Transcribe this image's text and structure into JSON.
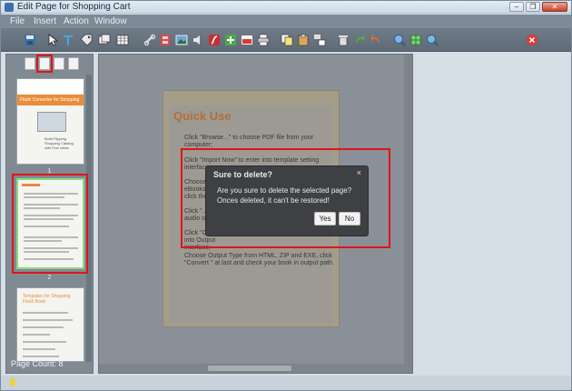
{
  "window": {
    "title": "Edit Page for Shopping Cart",
    "minimize": "–",
    "restore": "❐",
    "close": "✕"
  },
  "menu": {
    "items": [
      "File",
      "Insert",
      "Action",
      "Window"
    ]
  },
  "toolbar": {
    "icons": [
      "save-icon",
      "pointer-icon",
      "text-icon",
      "tag-icon",
      "picture-icon",
      "table-icon",
      "link-icon",
      "film-icon",
      "image-icon",
      "audio-icon",
      "flash-icon",
      "add-icon",
      "youtube-icon",
      "print-icon",
      "copy-icon",
      "paste-icon",
      "align-icon",
      "delete-icon",
      "redo-icon",
      "undo-icon",
      "zoom-in-icon",
      "fit-icon",
      "zoom-out-icon",
      "close-icon"
    ]
  },
  "left_panel": {
    "page_count": "Page Count: 8",
    "thumb1_title": "Flash Converter for Shopping",
    "thumb1_caption": "Build Flipping Shopping Catalog with Few clicks",
    "thumb1_num": "1",
    "thumb2_num": "2",
    "thumb3_title": "Templates for Shopping Flash Book"
  },
  "page": {
    "title": "Quick Use",
    "steps": [
      "Click  \"Browse...\" to choose PDF file from your computer;",
      "Click \"Import Now\" to enter into template setting interface;",
      "Choose... eBooks,... click the...",
      "Click \"...\" audio o...",
      "Click \"C... into Output interface;",
      "Choose Output Type from HTML, ZIP and EXE, click \"Convert \" at last and check your book in output path."
    ]
  },
  "dialog": {
    "title": "Sure to delete?",
    "close": "×",
    "message_line1": "Are you sure to delete the selected page?",
    "message_line2": "Onces deleted, it can't be restored!",
    "yes": "Yes",
    "no": "No"
  },
  "colors": {
    "highlight": "#e0141b",
    "page_title": "#b36e34",
    "dialog_bg": "#3f4043"
  }
}
